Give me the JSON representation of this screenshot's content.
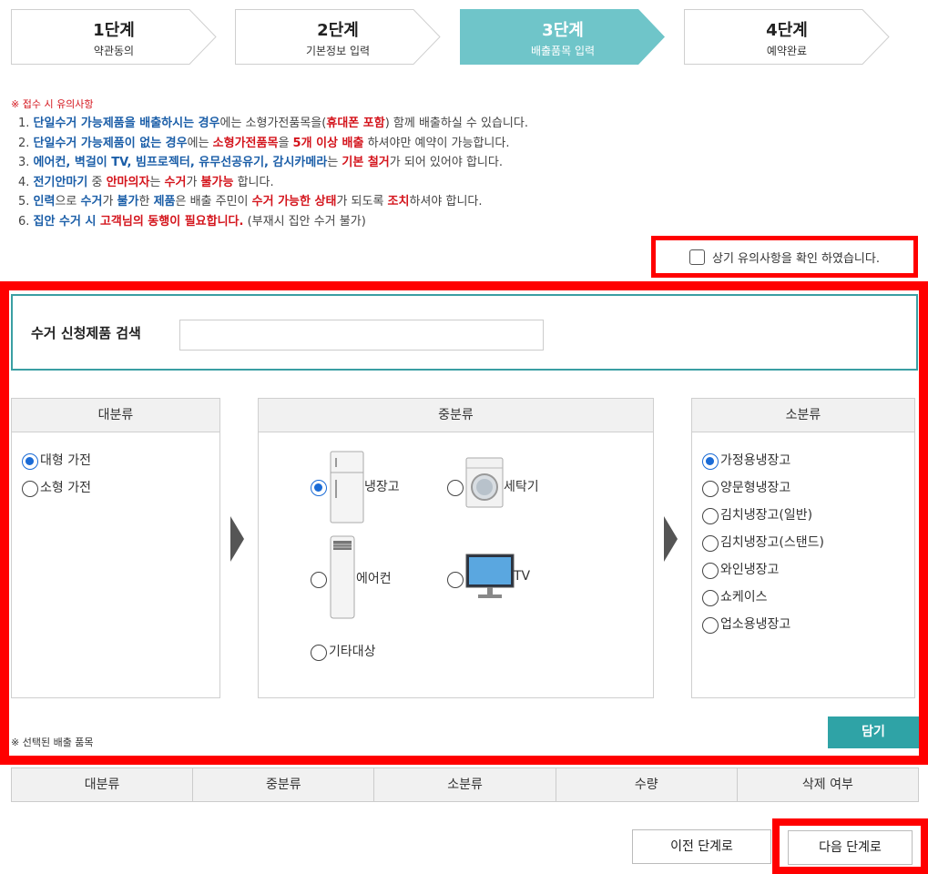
{
  "steps": [
    {
      "num": "1단계",
      "label": "약관동의",
      "active": false
    },
    {
      "num": "2단계",
      "label": "기본정보 입력",
      "active": false
    },
    {
      "num": "3단계",
      "label": "배출품목 입력",
      "active": true
    },
    {
      "num": "4단계",
      "label": "예약완료",
      "active": false
    }
  ],
  "notice": {
    "title": "※ 접수 시 유의사항",
    "items": [
      [
        [
          "1. ",
          ""
        ],
        [
          "단일수거 가능제품을 배출하시는 경우",
          "b"
        ],
        [
          "에는 소형가전품목을(",
          ""
        ],
        [
          "휴대폰 포함",
          "r"
        ],
        [
          ") 함께 배출하실 수 있습니다.",
          ""
        ]
      ],
      [
        [
          "2. ",
          ""
        ],
        [
          "단일수거 가능제품이 없는 경우",
          "b"
        ],
        [
          "에는 ",
          ""
        ],
        [
          "소형가전품목",
          "r"
        ],
        [
          "을 ",
          ""
        ],
        [
          "5개 이상 배출",
          "r"
        ],
        [
          " 하셔야만 예약이 가능합니다.",
          ""
        ]
      ],
      [
        [
          "3. ",
          ""
        ],
        [
          "에어컨, 벽걸이 TV, 빔프로젝터, 유무선공유기, 감시카메라",
          "b"
        ],
        [
          "는 ",
          ""
        ],
        [
          "기본 철거",
          "r"
        ],
        [
          "가 되어 있어야 합니다.",
          ""
        ]
      ],
      [
        [
          "4. ",
          ""
        ],
        [
          "전기안마기",
          "b"
        ],
        [
          " 중 ",
          ""
        ],
        [
          "안마의자",
          "r"
        ],
        [
          "는 ",
          ""
        ],
        [
          "수거",
          "r"
        ],
        [
          "가 ",
          ""
        ],
        [
          "불가능",
          "r"
        ],
        [
          " 합니다.",
          ""
        ]
      ],
      [
        [
          "5. ",
          ""
        ],
        [
          "인력",
          "b"
        ],
        [
          "으로 ",
          ""
        ],
        [
          "수거",
          "b"
        ],
        [
          "가 ",
          ""
        ],
        [
          "불가",
          "b"
        ],
        [
          "한 ",
          ""
        ],
        [
          "제품",
          "b"
        ],
        [
          "은 배출 주민이 ",
          ""
        ],
        [
          "수거 가능한 상태",
          "r"
        ],
        [
          "가 되도록 ",
          ""
        ],
        [
          "조치",
          "r"
        ],
        [
          "하셔야 합니다.",
          ""
        ]
      ],
      [
        [
          "6. ",
          ""
        ],
        [
          "집안 수거 시 ",
          "b"
        ],
        [
          "고객님의 동행이 필요합니다.",
          "r"
        ],
        [
          " (부재시 집안 수거 불가)",
          ""
        ]
      ]
    ],
    "confirm_label": "상기 유의사항을 확인 하였습니다."
  },
  "search": {
    "label": "수거 신청제품 검색",
    "value": ""
  },
  "panels": {
    "major": {
      "title": "대분류",
      "options": [
        {
          "label": "대형 가전",
          "selected": true
        },
        {
          "label": "소형 가전",
          "selected": false
        }
      ]
    },
    "middle": {
      "title": "중분류",
      "options": [
        {
          "label": "냉장고",
          "selected": true,
          "icon": "refrigerator-icon"
        },
        {
          "label": "세탁기",
          "selected": false,
          "icon": "washing-machine-icon"
        },
        {
          "label": "에어컨",
          "selected": false,
          "icon": "air-conditioner-icon"
        },
        {
          "label": "TV",
          "selected": false,
          "icon": "tv-icon"
        },
        {
          "label": "기타대상",
          "selected": false
        }
      ]
    },
    "minor": {
      "title": "소분류",
      "options": [
        {
          "label": "가정용냉장고",
          "selected": true
        },
        {
          "label": "양문형냉장고",
          "selected": false
        },
        {
          "label": "김치냉장고(일반)",
          "selected": false
        },
        {
          "label": "김치냉장고(스탠드)",
          "selected": false
        },
        {
          "label": "와인냉장고",
          "selected": false
        },
        {
          "label": "쇼케이스",
          "selected": false
        },
        {
          "label": "업소용냉장고",
          "selected": false
        }
      ]
    }
  },
  "selected_label": "※ 선택된 배출 품목",
  "put_button": "담기",
  "table_headers": [
    "대분류",
    "중분류",
    "소분류",
    "수량",
    "삭제 여부"
  ],
  "buttons": {
    "prev": "이전 단계로",
    "next": "다음 단계로"
  },
  "colors": {
    "accent": "#6fc5c9",
    "teal_button": "#2fa3a6",
    "highlight_red": "#ff0000",
    "radio_blue": "#1a6bd6",
    "notice_blue": "#1b5ea8",
    "notice_red": "#d4141c"
  }
}
